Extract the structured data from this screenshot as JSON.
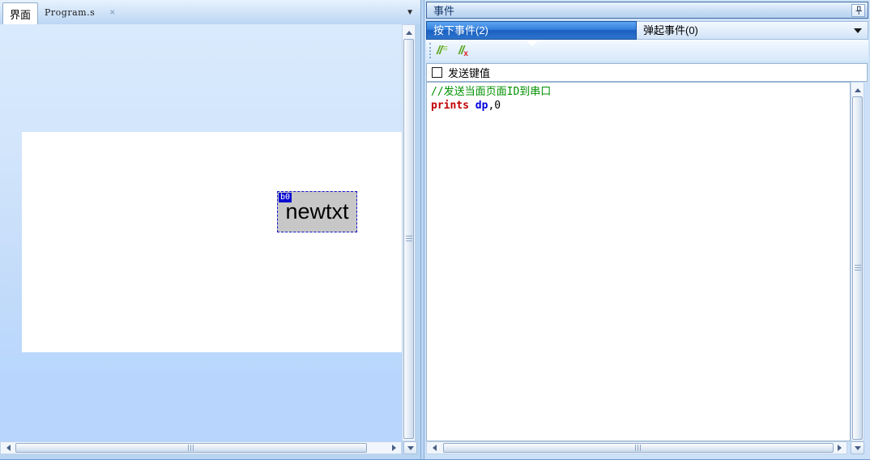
{
  "left_panel": {
    "tab_interface": "界面",
    "tab_program": "Program.s",
    "close_icon": "×",
    "overflow_icon": "▼",
    "page": {
      "component_id": "b0",
      "component_text": "newtxt"
    }
  },
  "right_panel": {
    "title": "事件",
    "press_tab": "按下事件(2)",
    "release_tab": "弹起事件(0)",
    "toolbar": {
      "comment_slashes": "//",
      "comment_lines": "≡",
      "uncomment_slashes": "//",
      "uncomment_x": "x"
    },
    "checkbox_label": "发送键值",
    "code": {
      "line1_comment": "//发送当面页面ID到串口",
      "line2_keyword": "prints",
      "line2_variable": "dp",
      "line2_rest": ",0"
    }
  },
  "colors": {
    "active_event_tab": "#1f64c4",
    "comment_green": "#009100",
    "keyword_red": "#c00000",
    "variable_blue": "#0000dd",
    "selection_border": "#1414cc",
    "component_bg": "#c7c7c7"
  }
}
